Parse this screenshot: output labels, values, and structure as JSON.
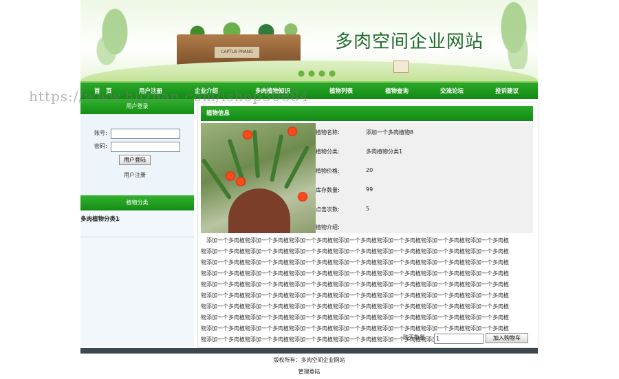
{
  "site": {
    "title": "多肉空间企业网站",
    "planter_text": "CAPTUS PRANG"
  },
  "nav": [
    {
      "label": "首　页"
    },
    {
      "label": "用户注册"
    },
    {
      "label": "企业介绍"
    },
    {
      "label": "多肉植物知识"
    },
    {
      "label": "植物列表"
    },
    {
      "label": "植物查询"
    },
    {
      "label": "交流论坛"
    },
    {
      "label": "投诉建议"
    }
  ],
  "login": {
    "title": "用户登录",
    "account_label": "账号:",
    "account_value": "",
    "password_label": "密码:",
    "password_value": "",
    "login_button": "用户登陆",
    "register_link": "用户注册"
  },
  "categories": {
    "title": "植物分类",
    "items": [
      "多肉植物分类1"
    ]
  },
  "product": {
    "section_title": "植物信息",
    "fields": [
      {
        "label": "植物名称:",
        "value": "添加一个多肉植物8"
      },
      {
        "label": "植物分类:",
        "value": "多肉植物分类1"
      },
      {
        "label": "植物价格:",
        "value": "20"
      },
      {
        "label": "库存数量:",
        "value": "99"
      },
      {
        "label": "点击次数:",
        "value": "5"
      },
      {
        "label": "植物介绍:",
        "value": ""
      }
    ],
    "description": "添加一个多肉植物添加一个多肉植物添加一个多肉植物添加一个多肉植物添加一个多肉植物添加一个多肉植物添加一个多肉植物添加一个多肉植物添加一个多肉植物添加一个多肉植物添加一个多肉植物添加一个多肉植物添加一个多肉植物添加一个多肉植物添加一个多肉植物添加一个多肉植物添加一个多肉植物添加一个多肉植物添加一个多肉植物添加一个多肉植物添加一个多肉植物添加一个多肉植物添加一个多肉植物添加一个多肉植物添加一个多肉植物添加一个多肉植物添加一个多肉植物添加一个多肉植物添加一个多肉植物添加一个多肉植物添加一个多肉植物添加一个多肉植物添加一个多肉植物添加一个多肉植物添加一个多肉植物添加一个多肉植物添加一个多肉植物添加一个多肉植物添加一个多肉植物添加一个多肉植物添加一个多肉植物添加一个多肉植物添加一个多肉植物添加一个多肉植物添加一个多肉植物添加一个多肉植物添加一个多肉植物添加一个多肉植物添加一个多肉植物添加一个多肉植物添加一个多肉植物添加一个多肉植物添加一个多肉植物添加一个多肉植物添加一个多肉植物添加一个多肉植物添加一个多肉植物添加一个多肉植物添加一个多肉植物添加一个多肉植物添加一个多肉植物添加一个多肉植物添加一个多肉植物添加一个多肉植物添加一个多肉植物添加一个多肉植物添加一个多肉植物添加一个多肉植物添加一个多肉植物",
    "quantity_label": "购买数量:",
    "quantity_value": "1",
    "add_to_cart": "加入购物车"
  },
  "footer": {
    "copyright": "版权所有：多肉空间企业网站",
    "admin_link": "管理登陆"
  },
  "watermark": "https://www.huzhan.com/ishop30884"
}
